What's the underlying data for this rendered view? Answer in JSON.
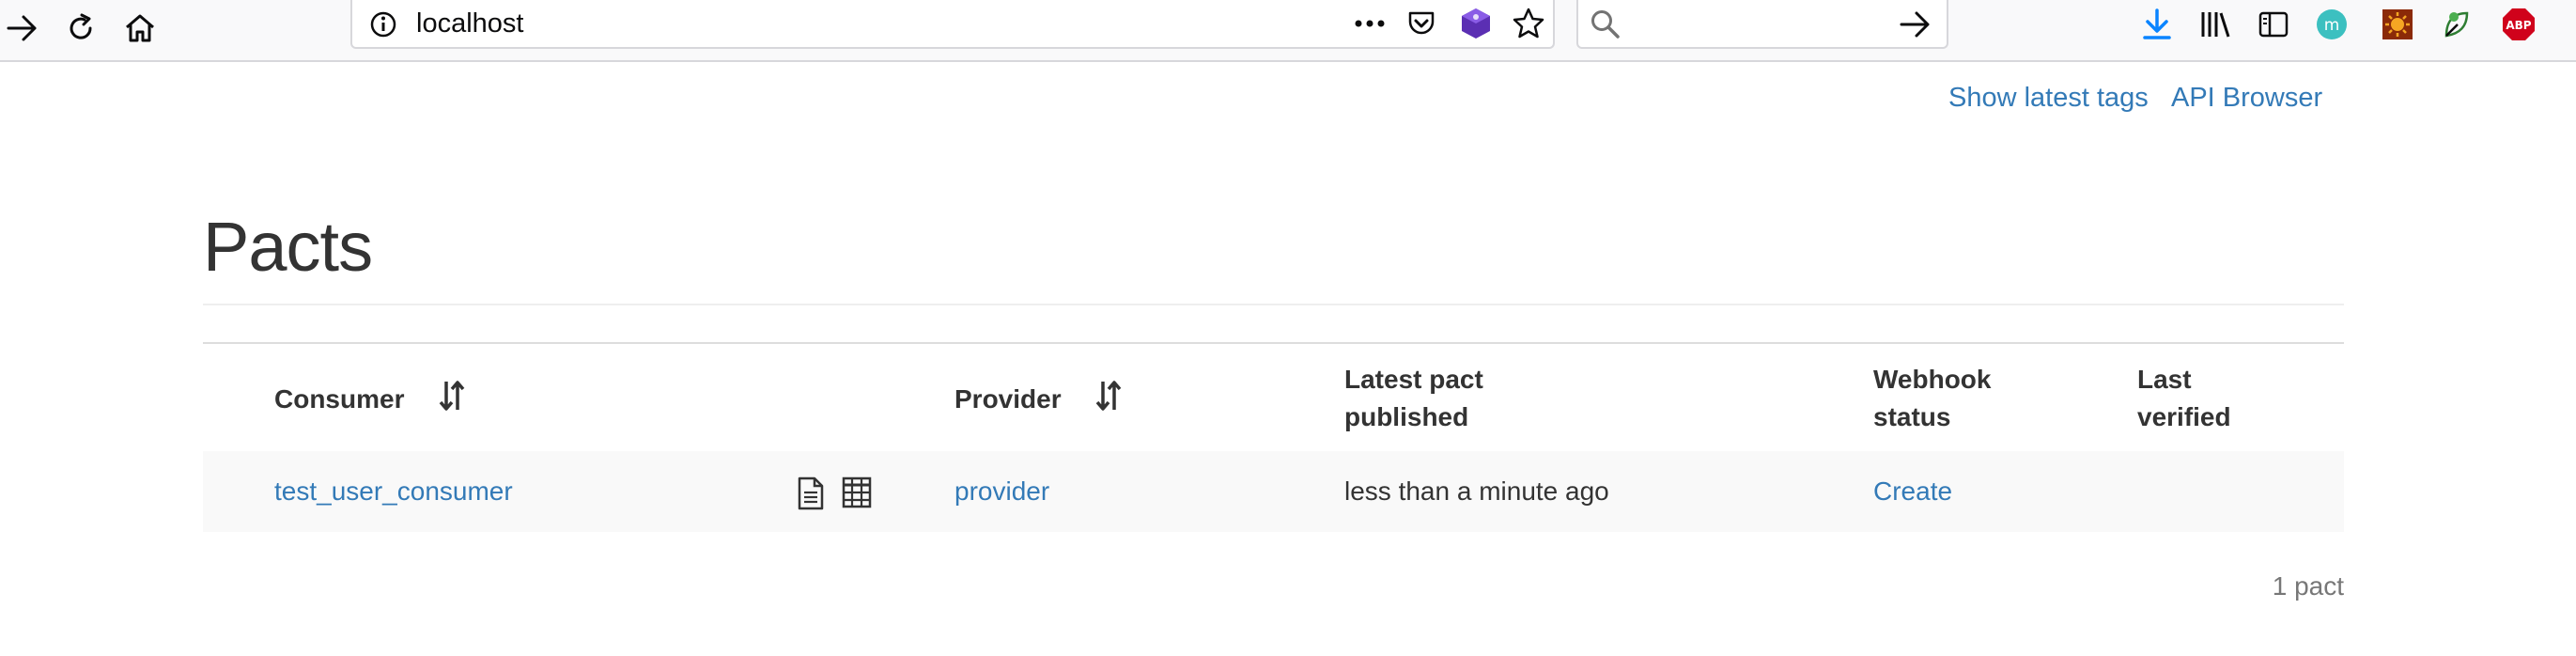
{
  "browser": {
    "url": "localhost"
  },
  "nav": {
    "show_latest_tags": "Show latest tags",
    "api_browser": "API Browser"
  },
  "page": {
    "title": "Pacts"
  },
  "table": {
    "headers": {
      "consumer": "Consumer",
      "provider": "Provider",
      "latest_pact_line1": "Latest pact",
      "latest_pact_line2": "published",
      "webhook_line1": "Webhook",
      "webhook_line2": "status",
      "last_verified_line1": "Last",
      "last_verified_line2": "verified"
    },
    "rows": [
      {
        "consumer": "test_user_consumer",
        "provider": "provider",
        "latest_pact_published": "less than a minute ago",
        "webhook_status": "Create",
        "last_verified": ""
      }
    ]
  },
  "footer": {
    "count": "1 pact"
  }
}
